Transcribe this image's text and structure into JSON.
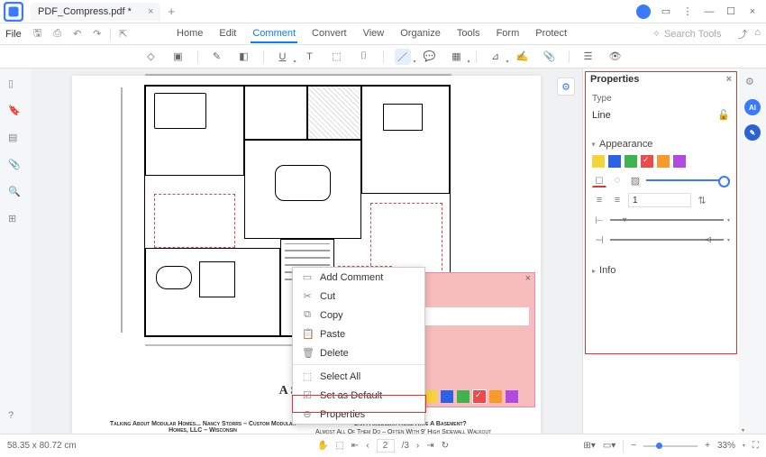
{
  "titlebar": {
    "tab_name": "PDF_Compress.pdf *"
  },
  "menubar": {
    "file": "File",
    "items": [
      "Home",
      "Edit",
      "Comment",
      "Convert",
      "View",
      "Organize",
      "Tools",
      "Form",
      "Protect"
    ],
    "active_index": 2,
    "search_placeholder": "Search Tools"
  },
  "context_menu": {
    "items": [
      {
        "icon": "💬",
        "label": "Add Comment"
      },
      {
        "icon": "✂",
        "label": "Cut"
      },
      {
        "icon": "⧉",
        "label": "Copy"
      },
      {
        "icon": "📋",
        "label": "Paste"
      },
      {
        "icon": "🗑",
        "label": "Delete"
      },
      {
        "sep": true
      },
      {
        "icon": "☑",
        "label": "Select All"
      },
      {
        "icon": "☑",
        "label": "Set as Default"
      },
      {
        "icon": "⊖",
        "label": "Properties"
      }
    ]
  },
  "page_content": {
    "title": "A Sense O",
    "col1_hdr": "Talking About Modular Homes... Nancy Storrs – Custom Modular Homes, LLC – Wisconsin",
    "col2_hdr": "Can A Modular Home Have A Basement?",
    "col2_body": "Almost All Of Them Do – Often With 9' High Sidewall Walkout Basements, And Expanded Living Areas On Lower Levels"
  },
  "properties": {
    "title": "Properties",
    "type_label": "Type",
    "type_value": "Line",
    "appearance_label": "Appearance",
    "colors": [
      "#f5d33b",
      "#2962e6",
      "#3fb34f",
      "#ef4a4a",
      "#f79a2a",
      "#b14ae0"
    ],
    "thickness": "1",
    "info_label": "Info"
  },
  "statusbar": {
    "dimensions": "58.35 x 80.72 cm",
    "page_current": "2",
    "page_total": "/3",
    "zoom": "33%"
  }
}
